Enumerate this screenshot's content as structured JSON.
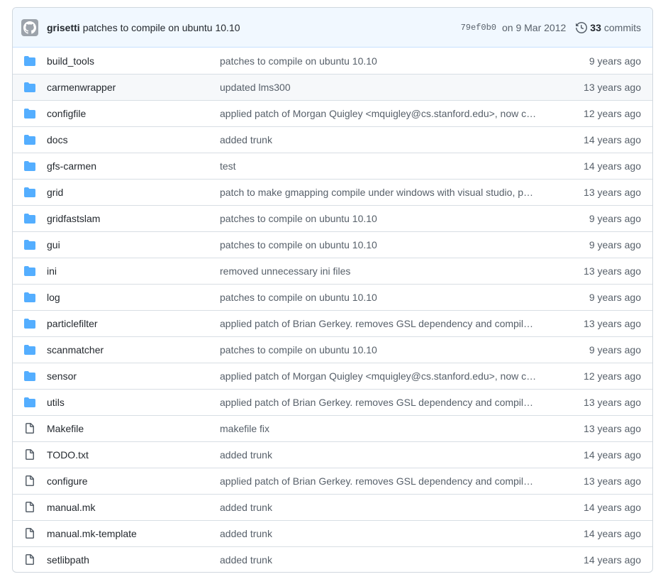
{
  "commit": {
    "author": "grisetti",
    "message": "patches to compile on ubuntu 10.10",
    "sha": "79ef0b0",
    "date": "on 9 Mar 2012",
    "commits_count": "33",
    "commits_label": "commits"
  },
  "colors": {
    "folder": "#54aeff",
    "file": "#57606a",
    "header_bg": "#f1f8ff"
  },
  "files": [
    {
      "name": "build_tools",
      "type": "folder",
      "message": "patches to compile on ubuntu 10.10",
      "age": "9 years ago"
    },
    {
      "name": "carmenwrapper",
      "type": "folder",
      "message": "updated lms300",
      "age": "13 years ago"
    },
    {
      "name": "configfile",
      "type": "folder",
      "message": "applied patch of Morgan Quigley <mquigley@cs.stanford.edu>, now compiles...",
      "age": "12 years ago"
    },
    {
      "name": "docs",
      "type": "folder",
      "message": "added trunk",
      "age": "14 years ago"
    },
    {
      "name": "gfs-carmen",
      "type": "folder",
      "message": "test",
      "age": "14 years ago"
    },
    {
      "name": "grid",
      "type": "folder",
      "message": "patch to make gmapping compile under windows with visual studio, pacth",
      "age": "13 years ago"
    },
    {
      "name": "gridfastslam",
      "type": "folder",
      "message": "patches to compile on ubuntu 10.10",
      "age": "9 years ago"
    },
    {
      "name": "gui",
      "type": "folder",
      "message": "patches to compile on ubuntu 10.10",
      "age": "9 years ago"
    },
    {
      "name": "ini",
      "type": "folder",
      "message": "removed unnecessary ini files",
      "age": "13 years ago"
    },
    {
      "name": "log",
      "type": "folder",
      "message": "patches to compile on ubuntu 10.10",
      "age": "9 years ago"
    },
    {
      "name": "particlefilter",
      "type": "folder",
      "message": "applied patch of Brian Gerkey. removes GSL dependency and compiles with...",
      "age": "13 years ago"
    },
    {
      "name": "scanmatcher",
      "type": "folder",
      "message": "patches to compile on ubuntu 10.10",
      "age": "9 years ago"
    },
    {
      "name": "sensor",
      "type": "folder",
      "message": "applied patch of Morgan Quigley <mquigley@cs.stanford.edu>, now compiles...",
      "age": "12 years ago"
    },
    {
      "name": "utils",
      "type": "folder",
      "message": "applied patch of Brian Gerkey. removes GSL dependency and compiles with...",
      "age": "13 years ago"
    },
    {
      "name": "Makefile",
      "type": "file",
      "message": "makefile fix",
      "age": "13 years ago"
    },
    {
      "name": "TODO.txt",
      "type": "file",
      "message": "added trunk",
      "age": "14 years ago"
    },
    {
      "name": "configure",
      "type": "file",
      "message": "applied patch of Brian Gerkey. removes GSL dependency and compiles with...",
      "age": "13 years ago"
    },
    {
      "name": "manual.mk",
      "type": "file",
      "message": "added trunk",
      "age": "14 years ago"
    },
    {
      "name": "manual.mk-template",
      "type": "file",
      "message": "added trunk",
      "age": "14 years ago"
    },
    {
      "name": "setlibpath",
      "type": "file",
      "message": "added trunk",
      "age": "14 years ago"
    }
  ]
}
